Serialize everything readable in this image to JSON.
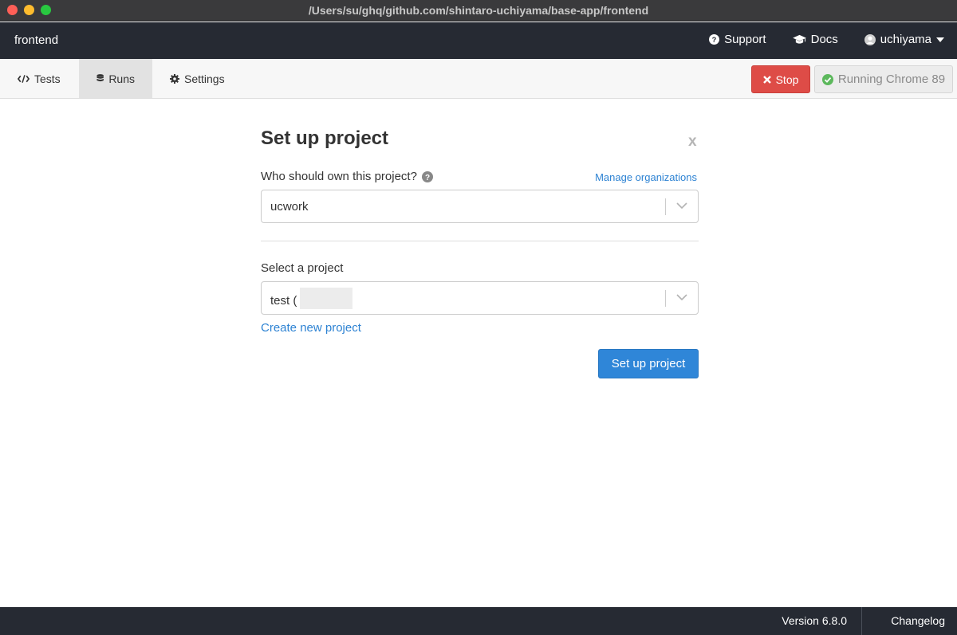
{
  "window": {
    "title": "/Users/su/ghq/github.com/shintaro-uchiyama/base-app/frontend"
  },
  "header": {
    "app_name": "frontend",
    "support_label": "Support",
    "docs_label": "Docs",
    "user_label": "uchiyama"
  },
  "nav": {
    "tabs": [
      {
        "label": "Tests",
        "icon": "code-icon"
      },
      {
        "label": "Runs",
        "icon": "database-icon",
        "active": true
      },
      {
        "label": "Settings",
        "icon": "gear-icon"
      }
    ],
    "stop_label": "Stop",
    "running_label": "Running Chrome 89"
  },
  "modal": {
    "title": "Set up project",
    "close_label": "x",
    "owner_question": "Who should own this project?",
    "manage_link": "Manage organizations",
    "owner_value": "ucwork",
    "project_label": "Select a project",
    "project_value": "test (",
    "create_link": "Create new project",
    "submit_label": "Set up project"
  },
  "footer": {
    "version": "Version 6.8.0",
    "changelog": "Changelog"
  },
  "colors": {
    "header_bg": "#262a33",
    "accent_blue": "#2f86d8",
    "stop_red": "#de4c47",
    "running_green": "#5cb85c"
  }
}
